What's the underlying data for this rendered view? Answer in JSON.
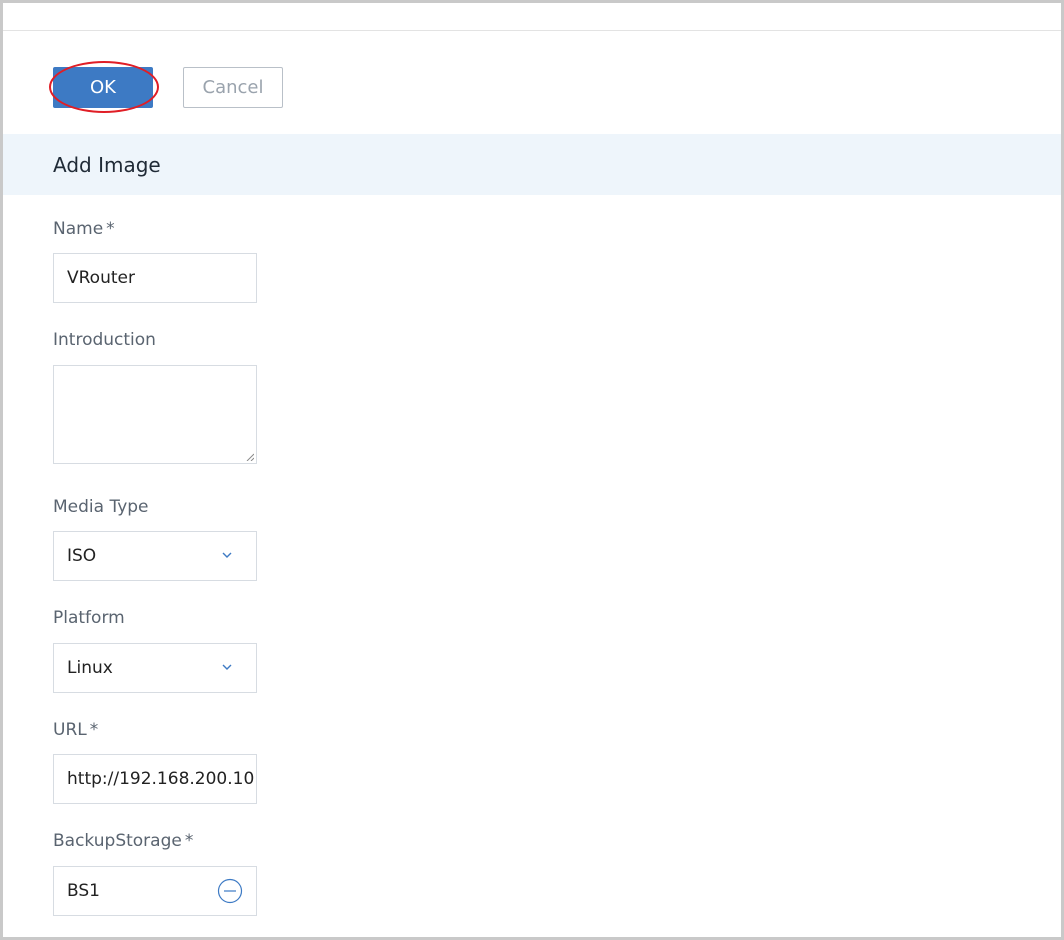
{
  "toolbar": {
    "ok_label": "OK",
    "cancel_label": "Cancel"
  },
  "section": {
    "title": "Add Image"
  },
  "form": {
    "name": {
      "label": "Name",
      "required_mark": "*",
      "value": "VRouter"
    },
    "introduction": {
      "label": "Introduction",
      "value": ""
    },
    "media_type": {
      "label": "Media Type",
      "value": "ISO"
    },
    "platform": {
      "label": "Platform",
      "value": "Linux"
    },
    "url": {
      "label": "URL",
      "required_mark": "*",
      "value": "http://192.168.200.10"
    },
    "backup_storage": {
      "label": "BackupStorage",
      "required_mark": "*",
      "value": "BS1"
    }
  },
  "icons": {
    "media_type_dropdown": "chevron-down-icon",
    "platform_dropdown": "chevron-down-icon",
    "backup_storage_remove": "minus-circle-icon"
  },
  "colors": {
    "primary": "#3d7ac4",
    "highlight": "#e01e26",
    "section_bg": "#eef5fb"
  }
}
